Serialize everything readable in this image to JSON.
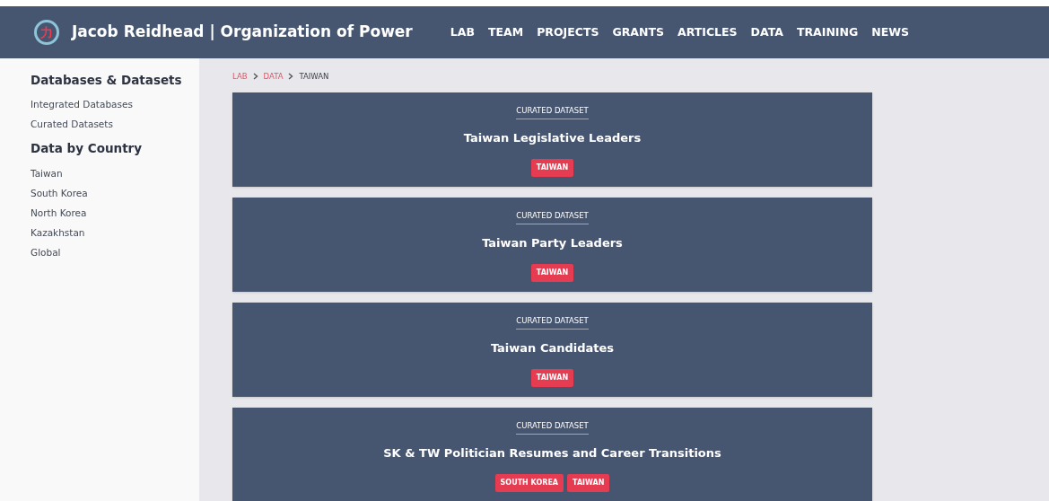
{
  "header": {
    "logo_glyph": "力",
    "title": "Jacob Reidhead | Organization of Power",
    "nav": [
      "LAB",
      "TEAM",
      "PROJECTS",
      "GRANTS",
      "ARTICLES",
      "DATA",
      "TRAINING",
      "NEWS"
    ]
  },
  "sidebar": {
    "sections": [
      {
        "heading": "Databases & Datasets",
        "items": [
          "Integrated Databases",
          "Curated Datasets"
        ]
      },
      {
        "heading": "Data by Country",
        "items": [
          "Taiwan",
          "South Korea",
          "North Korea",
          "Kazakhstan",
          "Global"
        ]
      }
    ]
  },
  "breadcrumb": [
    {
      "label": "LAB",
      "kind": "link"
    },
    {
      "label": "DATA",
      "kind": "link"
    },
    {
      "label": "TAIWAN",
      "kind": "current"
    }
  ],
  "cards": [
    {
      "category": "CURATED DATASET",
      "title": "Taiwan Legislative Leaders",
      "tags": [
        "TAIWAN"
      ]
    },
    {
      "category": "CURATED DATASET",
      "title": "Taiwan Party Leaders",
      "tags": [
        "TAIWAN"
      ]
    },
    {
      "category": "CURATED DATASET",
      "title": "Taiwan Candidates",
      "tags": [
        "TAIWAN"
      ]
    },
    {
      "category": "CURATED DATASET",
      "title": "SK & TW Politician Resumes and Career Transitions",
      "tags": [
        "SOUTH KOREA",
        "TAIWAN"
      ]
    }
  ]
}
